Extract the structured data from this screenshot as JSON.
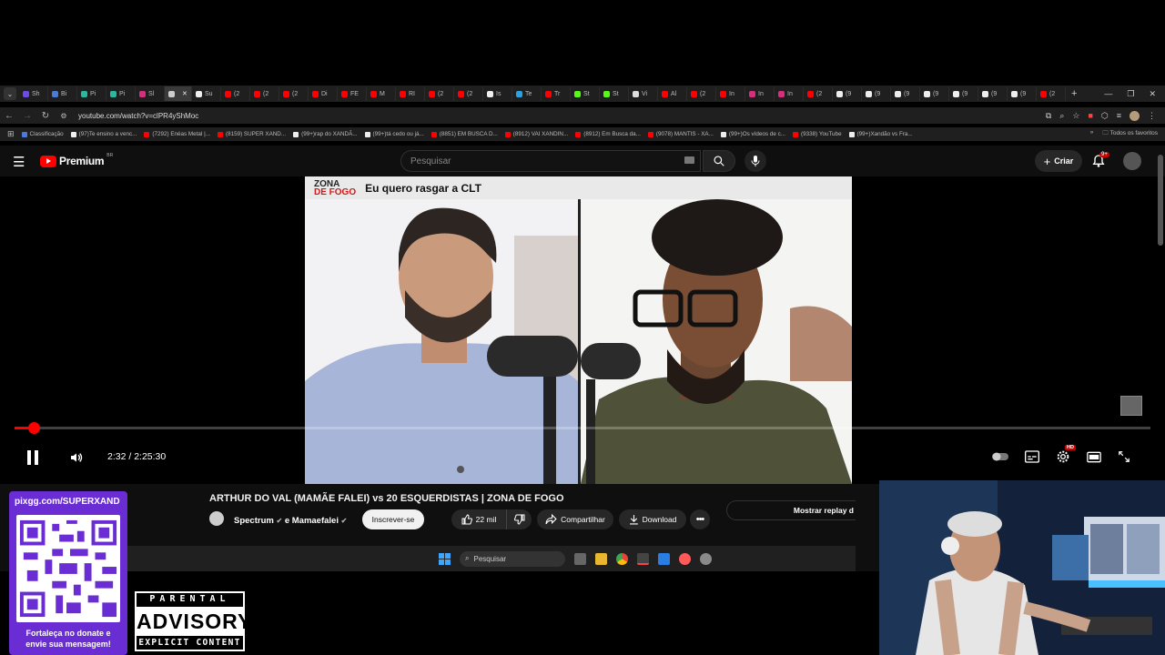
{
  "browser": {
    "tabs": [
      {
        "label": "Sh",
        "icon": "purple-s-icon",
        "color": "#6b4ce6"
      },
      {
        "label": "Bi",
        "icon": "blue-c-icon",
        "color": "#4a7bd8"
      },
      {
        "label": "Pi",
        "icon": "pix-icon",
        "color": "#2bb7a0"
      },
      {
        "label": "Pi",
        "icon": "pix-icon",
        "color": "#2bb7a0"
      },
      {
        "label": "Sl",
        "icon": "instagram-icon",
        "color": "#d6307c"
      },
      {
        "label": "",
        "icon": "speaker-icon",
        "color": "#cccccc",
        "active": true
      },
      {
        "label": "Su",
        "icon": "tiktok-icon",
        "color": "#eeeeee"
      },
      {
        "label": "(2",
        "icon": "youtube-icon",
        "color": "#ff0000"
      },
      {
        "label": "(2",
        "icon": "youtube-icon",
        "color": "#ff0000"
      },
      {
        "label": "(2",
        "icon": "youtube-icon",
        "color": "#ff0000"
      },
      {
        "label": "Di",
        "icon": "youtube-icon",
        "color": "#ff0000"
      },
      {
        "label": "FE",
        "icon": "youtube-icon",
        "color": "#ff0000"
      },
      {
        "label": "M",
        "icon": "youtube-icon",
        "color": "#ff0000"
      },
      {
        "label": "RI",
        "icon": "youtube-icon",
        "color": "#ff0000"
      },
      {
        "label": "(2",
        "icon": "youtube-icon",
        "color": "#ff0000"
      },
      {
        "label": "(2",
        "icon": "youtube-icon",
        "color": "#ff0000"
      },
      {
        "label": "Is",
        "icon": "tiktok-icon",
        "color": "#eeeeee"
      },
      {
        "label": "Te",
        "icon": "telegram-icon",
        "color": "#2aa3e0"
      },
      {
        "label": "Tr",
        "icon": "youtube-icon",
        "color": "#ff0000"
      },
      {
        "label": "St",
        "icon": "kick-icon",
        "color": "#53fc18"
      },
      {
        "label": "St",
        "icon": "kick-icon",
        "color": "#53fc18"
      },
      {
        "label": "Vi",
        "icon": "chrome-icon",
        "color": "#dddddd"
      },
      {
        "label": "Al",
        "icon": "youtube-icon",
        "color": "#ff0000"
      },
      {
        "label": "(2",
        "icon": "youtube-icon",
        "color": "#ff0000"
      },
      {
        "label": "In",
        "icon": "youtube-icon",
        "color": "#ff0000"
      },
      {
        "label": "In",
        "icon": "instagram-icon",
        "color": "#d6307c"
      },
      {
        "label": "In",
        "icon": "instagram-icon",
        "color": "#d6307c"
      },
      {
        "label": "(2",
        "icon": "youtube-icon",
        "color": "#ff0000"
      },
      {
        "label": "(9",
        "icon": "tiktok-icon",
        "color": "#eeeeee"
      },
      {
        "label": "(9",
        "icon": "tiktok-icon",
        "color": "#eeeeee"
      },
      {
        "label": "(9",
        "icon": "tiktok-icon",
        "color": "#eeeeee"
      },
      {
        "label": "(9",
        "icon": "tiktok-icon",
        "color": "#eeeeee"
      },
      {
        "label": "(9",
        "icon": "tiktok-icon",
        "color": "#eeeeee"
      },
      {
        "label": "(9",
        "icon": "tiktok-icon",
        "color": "#eeeeee"
      },
      {
        "label": "(9",
        "icon": "tiktok-icon",
        "color": "#eeeeee"
      },
      {
        "label": "(2",
        "icon": "youtube-icon",
        "color": "#ff0000"
      }
    ],
    "url": "youtube.com/watch?v=clPR4yShMoc",
    "bookmarks": [
      {
        "label": "Classificação",
        "color": "#4a7bd8"
      },
      {
        "label": "(97)Te ensino a venc...",
        "color": "#eeeeee"
      },
      {
        "label": "(7292) Enéas Metal |...",
        "color": "#ff0000"
      },
      {
        "label": "(8159) SUPER XAND...",
        "color": "#ff0000"
      },
      {
        "label": "(99+)rap do XANDÃ...",
        "color": "#eeeeee"
      },
      {
        "label": "(99+)tá cedo ou já...",
        "color": "#eeeeee"
      },
      {
        "label": "(8851) EM BUSCA D...",
        "color": "#ff0000"
      },
      {
        "label": "(8912) VAI XANDIN...",
        "color": "#ff0000"
      },
      {
        "label": "(8912) Em Busca da...",
        "color": "#ff0000"
      },
      {
        "label": "(9078) MANTIS - XA...",
        "color": "#ff0000"
      },
      {
        "label": "(99+)Os vídeos de c...",
        "color": "#eeeeee"
      },
      {
        "label": "(9338) YouTube",
        "color": "#ff0000"
      },
      {
        "label": "(99+)Xandão vs Fra...",
        "color": "#eeeeee"
      }
    ],
    "all_bookmarks_label": "Todos os favoritos"
  },
  "youtube": {
    "logo_text": "Premium",
    "country_code": "BR",
    "search_placeholder": "Pesquisar",
    "create_label": "Criar",
    "notif_count": "9+"
  },
  "video": {
    "overlay_brand_top": "ZONA",
    "overlay_brand_bottom": "DE FOGO",
    "overlay_caption": "Eu quero rasgar a CLT",
    "progress_fraction": 0.017,
    "time_current": "2:32",
    "time_total": "2:25:30",
    "quality_badge": "HD",
    "title": "ARTHUR DO VAL (MAMÃE FALEI) vs 20 ESQUERDISTAS | ZONA DE FOGO",
    "channel_1": "Spectrum",
    "channel_joiner": "e",
    "channel_2": "Mamaefalei",
    "subscribe_label": "Inscrever-se",
    "likes": "22 mil",
    "share_label": "Compartilhar",
    "download_label": "Download",
    "replay_label": "Mostrar replay d"
  },
  "taskbar": {
    "search_placeholder": "Pesquisar"
  },
  "overlay": {
    "pix_url": "pixgg.com/SUPERXAND",
    "pix_message_line1": "Fortaleça no donate e",
    "pix_message_line2": "envie sua mensagem!",
    "advisory_top": "PARENTAL",
    "advisory_mid": "ADVISORY",
    "advisory_bottom": "EXPLICIT CONTENT"
  },
  "colors": {
    "accent_red": "#ff0000",
    "yt_bg": "#0f0f0f",
    "pix_purple": "#6a2dd4"
  }
}
